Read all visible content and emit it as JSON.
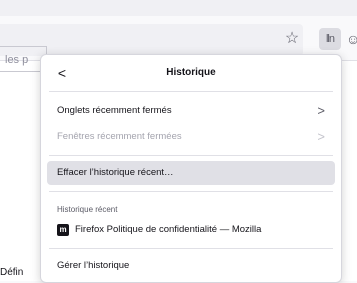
{
  "toolbar": {
    "bookmark_icon": "star-icon",
    "library_label": "lln",
    "account_glyph": "☺"
  },
  "page": {
    "search_text": "les p",
    "bottom_text": "Défin"
  },
  "panel": {
    "back_glyph": "<",
    "title": "Historique",
    "items": [
      {
        "label": "Onglets récemment fermés",
        "chevron": ">",
        "enabled": true
      },
      {
        "label": "Fenêtres récemment fermées",
        "chevron": ">",
        "enabled": false
      },
      {
        "label": "Effacer l’historique récent…",
        "highlighted": true
      },
      {
        "label": "Firefox Politique de confidentialité — Mozilla",
        "favicon": "m"
      },
      {
        "label": "Gérer l’historique"
      }
    ],
    "recent_header": "Historique récent"
  },
  "colors": {
    "panel_bg": "#ffffff",
    "hover_bg": "#e0e0e6",
    "disabled_text": "#a4a4ae"
  }
}
